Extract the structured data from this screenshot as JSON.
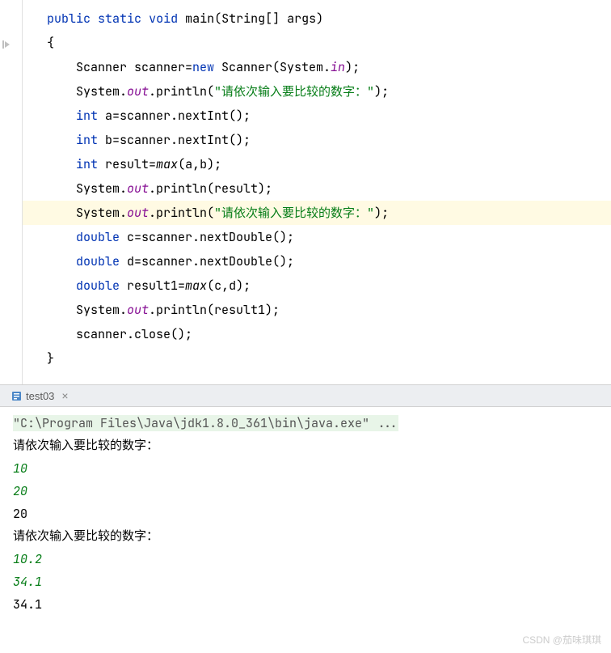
{
  "code": {
    "l1_kw1": "public",
    "l1_kw2": "static",
    "l1_kw3": "void",
    "l1_method": "main",
    "l1_rest": "(String[] args)",
    "l2": "{",
    "l3_p1": "    Scanner scanner=",
    "l3_kw": "new",
    "l3_p2": " Scanner(System.",
    "l3_field": "in",
    "l3_p3": ");",
    "l4_p1": "    System.",
    "l4_field": "out",
    "l4_p2": ".println(",
    "l4_str": "\"请依次输入要比较的数字：\"",
    "l4_p3": ");",
    "l5_kw": "int",
    "l5_rest": " a=scanner.nextInt();",
    "l6_kw": "int",
    "l6_rest": " b=scanner.nextInt();",
    "l7_kw": "int",
    "l7_p1": " result=",
    "l7_method": "max",
    "l7_p2": "(a,b);",
    "l8_p1": "    System.",
    "l8_field": "out",
    "l8_p2": ".println(result);",
    "l9_p1": "    System.",
    "l9_field": "out",
    "l9_p2": ".println(",
    "l9_str": "\"请依次输入要比较的数字：\"",
    "l9_p3": ");",
    "l10_kw": "double",
    "l10_rest": " c=scanner.nextDouble();",
    "l11_kw": "double",
    "l11_rest": " d=scanner.nextDouble();",
    "l12_kw": "double",
    "l12_p1": " result1=",
    "l12_method": "max",
    "l12_p2": "(c,d);",
    "l13_p1": "    System.",
    "l13_field": "out",
    "l13_p2": ".println(result1);",
    "l14": "    scanner.close();",
    "l15": "}"
  },
  "tab": {
    "label": "test03"
  },
  "console": {
    "cmd": "\"C:\\Program Files\\Java\\jdk1.8.0_361\\bin\\java.exe\" ...",
    "line1": "请依次输入要比较的数字：",
    "line2": "10",
    "line3": "20",
    "line4": "20",
    "line5": "请依次输入要比较的数字：",
    "line6": "10.2",
    "line7": "34.1",
    "line8": "34.1"
  },
  "watermark": "CSDN @茄味琪琪"
}
